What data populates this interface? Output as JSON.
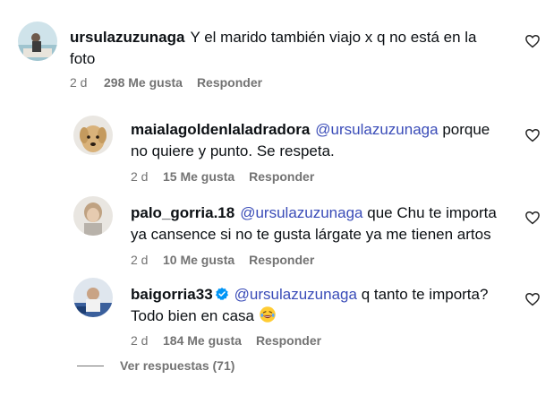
{
  "comments": [
    {
      "username": "ursulazuzunaga",
      "mention": "",
      "text": "Y el marido también viajo x q no está en la foto",
      "time": "2 d",
      "likes": "298 Me gusta",
      "reply": "Responder",
      "verified": false
    },
    {
      "username": "maialagoldenlaladradora",
      "mention": "@ursulazuzunaga",
      "text": "porque no quiere y punto. Se respeta.",
      "time": "2 d",
      "likes": "15 Me gusta",
      "reply": "Responder",
      "verified": false
    },
    {
      "username": "palo_gorria.18",
      "mention": "@ursulazuzunaga",
      "text": "que Chu te importa ya cansence si no te gusta lárgate ya me tienen artos",
      "time": "2 d",
      "likes": "10 Me gusta",
      "reply": "Responder",
      "verified": false
    },
    {
      "username": "baigorria33",
      "mention": "@ursulazuzunaga",
      "text": "q tanto te importa? Todo bien en casa",
      "time": "2 d",
      "likes": "184 Me gusta",
      "reply": "Responder",
      "verified": true,
      "emoji": "laughing-face"
    }
  ],
  "view_replies": "Ver respuestas (71)",
  "colors": {
    "text": "#0c1014",
    "secondary": "#737373",
    "mention": "#3a4cb8",
    "verified": "#0095f6"
  },
  "icons": {
    "like": "heart-outline-icon",
    "verified": "verified-badge-icon"
  }
}
